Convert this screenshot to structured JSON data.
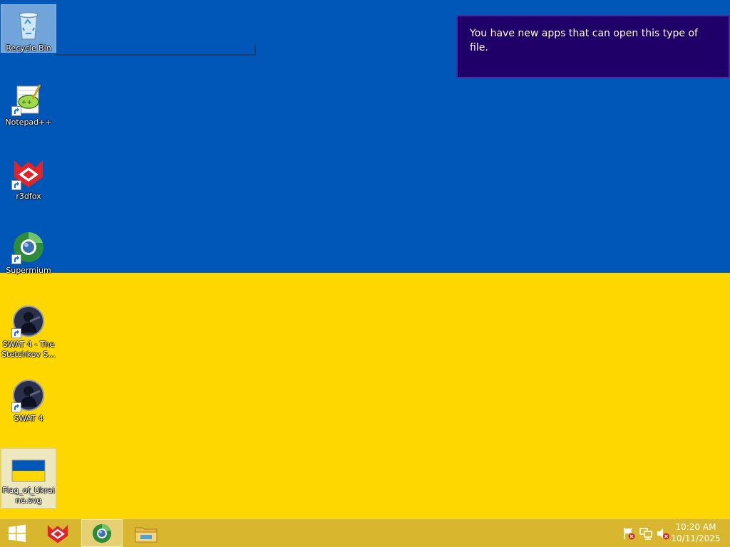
{
  "desktop": {
    "wallpaper_colors": {
      "top": "#0057b7",
      "bottom": "#ffd700"
    },
    "icons": [
      {
        "label": "Recycle Bin",
        "icon": "recycle-bin-icon",
        "shortcut": false
      },
      {
        "label": "Notepad++",
        "icon": "notepad-plus-plus-icon",
        "shortcut": true
      },
      {
        "label": "r3dfox",
        "icon": "r3dfox-icon",
        "shortcut": true
      },
      {
        "label": "Supermium",
        "icon": "supermium-icon",
        "shortcut": true
      },
      {
        "label": "SWAT 4 - The Stetchkov S...",
        "icon": "swat4-icon",
        "shortcut": true
      },
      {
        "label": "SWAT 4",
        "icon": "swat4-icon",
        "shortcut": true
      },
      {
        "label": "Flag_of_Ukraine.svg",
        "icon": "ukraine-flag-file-icon",
        "shortcut": false
      }
    ]
  },
  "notification": {
    "message": "You have new apps that can open this type of file.",
    "colors": {
      "background": "#1f0068",
      "border": "#4a2aa0"
    }
  },
  "taskbar": {
    "color": "#d8b72e",
    "start_icon": "windows-logo-icon",
    "pinned": [
      {
        "icon": "r3dfox-icon",
        "active": false
      },
      {
        "icon": "supermium-icon",
        "active": true
      },
      {
        "icon": "file-explorer-icon",
        "active": false
      }
    ],
    "tray_icons": [
      "action-center-flag-icon",
      "network-icon",
      "volume-muted-icon"
    ],
    "clock": {
      "time": "10:20 AM",
      "date": "10/11/2025"
    }
  }
}
